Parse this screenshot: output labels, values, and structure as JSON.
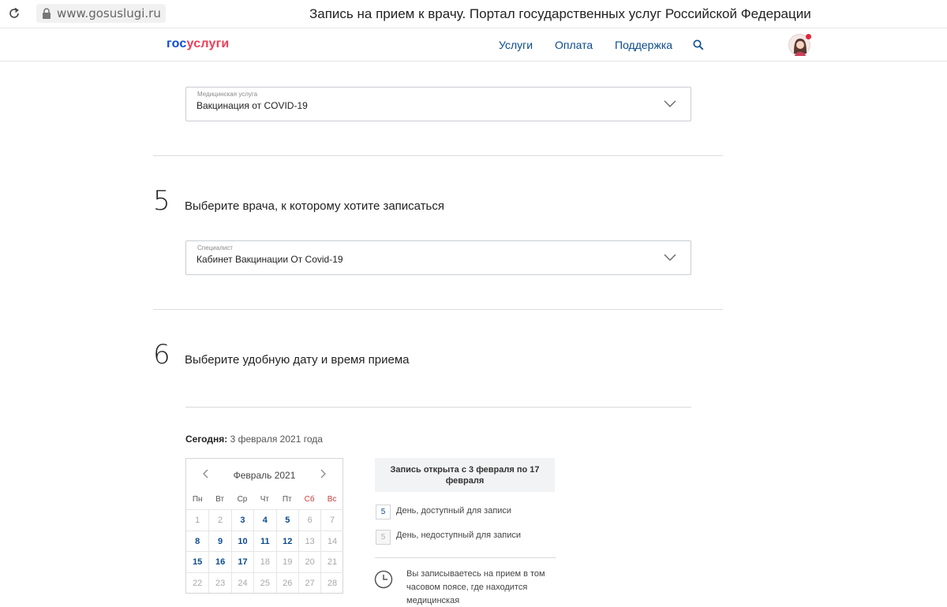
{
  "browser": {
    "url": "www.gosuslugi.ru",
    "title": "Запись на прием к врачу. Портал государственных услуг Российской Федерации"
  },
  "header": {
    "logo_part1": "гос",
    "logo_part2": "услуги",
    "nav": [
      "Услуги",
      "Оплата",
      "Поддержка"
    ]
  },
  "service": {
    "label": "Медицинская услуга",
    "value": "Вакцинация от COVID-19"
  },
  "step5": {
    "number": "5",
    "title": "Выберите врача, к которому хотите записаться",
    "select_label": "Специалист",
    "select_value": "Кабинет Вакцинации От Covid-19"
  },
  "step6": {
    "number": "6",
    "title": "Выберите удобную дату и время приема"
  },
  "today": {
    "label": "Сегодня:",
    "value": "3 февраля 2021 года"
  },
  "calendar": {
    "month": "Февраль 2021",
    "weekdays": [
      "Пн",
      "Вт",
      "Ср",
      "Чт",
      "Пт",
      "Сб",
      "Вс"
    ],
    "weeks": [
      [
        {
          "d": "1",
          "a": false
        },
        {
          "d": "2",
          "a": false
        },
        {
          "d": "3",
          "a": true
        },
        {
          "d": "4",
          "a": true
        },
        {
          "d": "5",
          "a": true
        },
        {
          "d": "6",
          "a": false
        },
        {
          "d": "7",
          "a": false
        }
      ],
      [
        {
          "d": "8",
          "a": true
        },
        {
          "d": "9",
          "a": true
        },
        {
          "d": "10",
          "a": true
        },
        {
          "d": "11",
          "a": true
        },
        {
          "d": "12",
          "a": true
        },
        {
          "d": "13",
          "a": false
        },
        {
          "d": "14",
          "a": false
        }
      ],
      [
        {
          "d": "15",
          "a": true
        },
        {
          "d": "16",
          "a": true
        },
        {
          "d": "17",
          "a": true
        },
        {
          "d": "18",
          "a": false
        },
        {
          "d": "19",
          "a": false
        },
        {
          "d": "20",
          "a": false
        },
        {
          "d": "21",
          "a": false
        }
      ],
      [
        {
          "d": "22",
          "a": false
        },
        {
          "d": "23",
          "a": false
        },
        {
          "d": "24",
          "a": false
        },
        {
          "d": "25",
          "a": false
        },
        {
          "d": "26",
          "a": false
        },
        {
          "d": "27",
          "a": false
        },
        {
          "d": "28",
          "a": false
        }
      ]
    ]
  },
  "info": {
    "open_text": "Запись открыта с 3 февраля по 17 февраля",
    "legend_available_num": "5",
    "legend_available": "День, доступный для записи",
    "legend_unavailable_num": "5",
    "legend_unavailable": "День, недоступный для записи",
    "timezone_note": "Вы записываетесь на прием в том часовом поясе, где находится медицинская"
  },
  "colors": {
    "link": "#0b4b8e",
    "brand_blue": "#0d4cd3",
    "brand_red": "#ee3f58",
    "weekend": "#d13b3b"
  }
}
